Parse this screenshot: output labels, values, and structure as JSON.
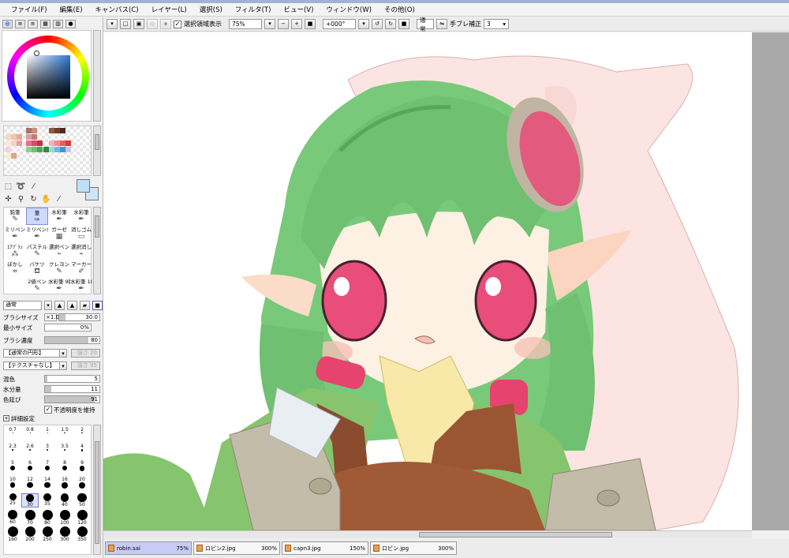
{
  "menu": [
    "ファイル(F)",
    "編集(E)",
    "キャンバス(C)",
    "レイヤー(L)",
    "選択(S)",
    "フィルタ(T)",
    "ビュー(V)",
    "ウィンドウ(W)",
    "その他(O)"
  ],
  "toolbar": {
    "show_selection_label": "選択領域表示",
    "show_selection_checked": "✓",
    "zoom": "75%",
    "rotation": "+000°",
    "blend_mode": "通常",
    "stabilizer_label": "手ブレ補正",
    "stabilizer_value": "3"
  },
  "brushes": [
    {
      "label": "鉛筆",
      "icon": "pencil-icon"
    },
    {
      "label": "筆",
      "icon": "brush-icon",
      "selected": true
    },
    {
      "label": "水彩筆",
      "icon": "watercolor-icon"
    },
    {
      "label": "水彩筆",
      "icon": "watercolor-icon"
    },
    {
      "label": "ミリペン",
      "icon": "pen-icon"
    },
    {
      "label": "ミリペンｵｾ",
      "icon": "pen-icon"
    },
    {
      "label": "ガーゼ",
      "icon": "gauze-icon"
    },
    {
      "label": "消しゴム",
      "icon": "eraser-icon"
    },
    {
      "label": "ｴｱﾌﾞﾗｼ",
      "icon": "airbrush-icon"
    },
    {
      "label": "パステル",
      "icon": "pastel-icon"
    },
    {
      "label": "選択ペン",
      "icon": "select-pen-icon"
    },
    {
      "label": "選択消し",
      "icon": "select-erase-icon"
    },
    {
      "label": "ぼかし",
      "icon": "blur-icon"
    },
    {
      "label": "バケツ",
      "icon": "bucket-icon"
    },
    {
      "label": "クレヨン",
      "icon": "crayon-icon"
    },
    {
      "label": "マーカー",
      "icon": "marker-icon"
    },
    {
      "label": "",
      "icon": ""
    },
    {
      "label": "2値ペン",
      "icon": "binary-pen-icon"
    },
    {
      "label": "水彩筆 9版",
      "icon": "watercolor-icon"
    },
    {
      "label": "水彩筆 10版",
      "icon": "watercolor-icon"
    }
  ],
  "brush_settings": {
    "mode": "通常",
    "size_label": "ブラシサイズ",
    "size_multiplier": "×1.0",
    "size_value": "30.0",
    "min_size_label": "最小サイズ",
    "min_size_value": "0%",
    "density_label": "ブラシ濃度",
    "density_value": "80",
    "shape_dropdown": "【通常の円形】",
    "shape_strength": "強さ",
    "shape_strength_value": "20",
    "texture_dropdown": "【テクスチャなし】",
    "texture_strength": "強さ",
    "texture_strength_value": "95",
    "blend_label": "混色",
    "blend_value": "5",
    "water_label": "水分量",
    "water_value": "11",
    "stretch_label": "色延び",
    "stretch_value": "91",
    "keep_opacity_label": "不透明度を維持",
    "keep_opacity_checked": "✓",
    "advanced_label": "詳細設定"
  },
  "sizes": [
    "0.7",
    "0.8",
    "1",
    "1.5",
    "2",
    "2.3",
    "2.6",
    "3",
    "3.5",
    "4",
    "5",
    "6",
    "7",
    "8",
    "9",
    "10",
    "12",
    "14",
    "16",
    "20",
    "25",
    "30",
    "35",
    "40",
    "50",
    "60",
    "70",
    "80",
    "100",
    "120",
    "160",
    "200",
    "250",
    "300",
    "350"
  ],
  "selected_size": "30",
  "canvas_tabs": [
    {
      "name": "robin.sai",
      "zoom": "75%",
      "active": true
    },
    {
      "name": "ロビン2.jpg",
      "zoom": "300%"
    },
    {
      "name": "capn3.jpg",
      "zoom": "150%"
    },
    {
      "name": "ロビン.jpg",
      "zoom": "300%"
    }
  ]
}
